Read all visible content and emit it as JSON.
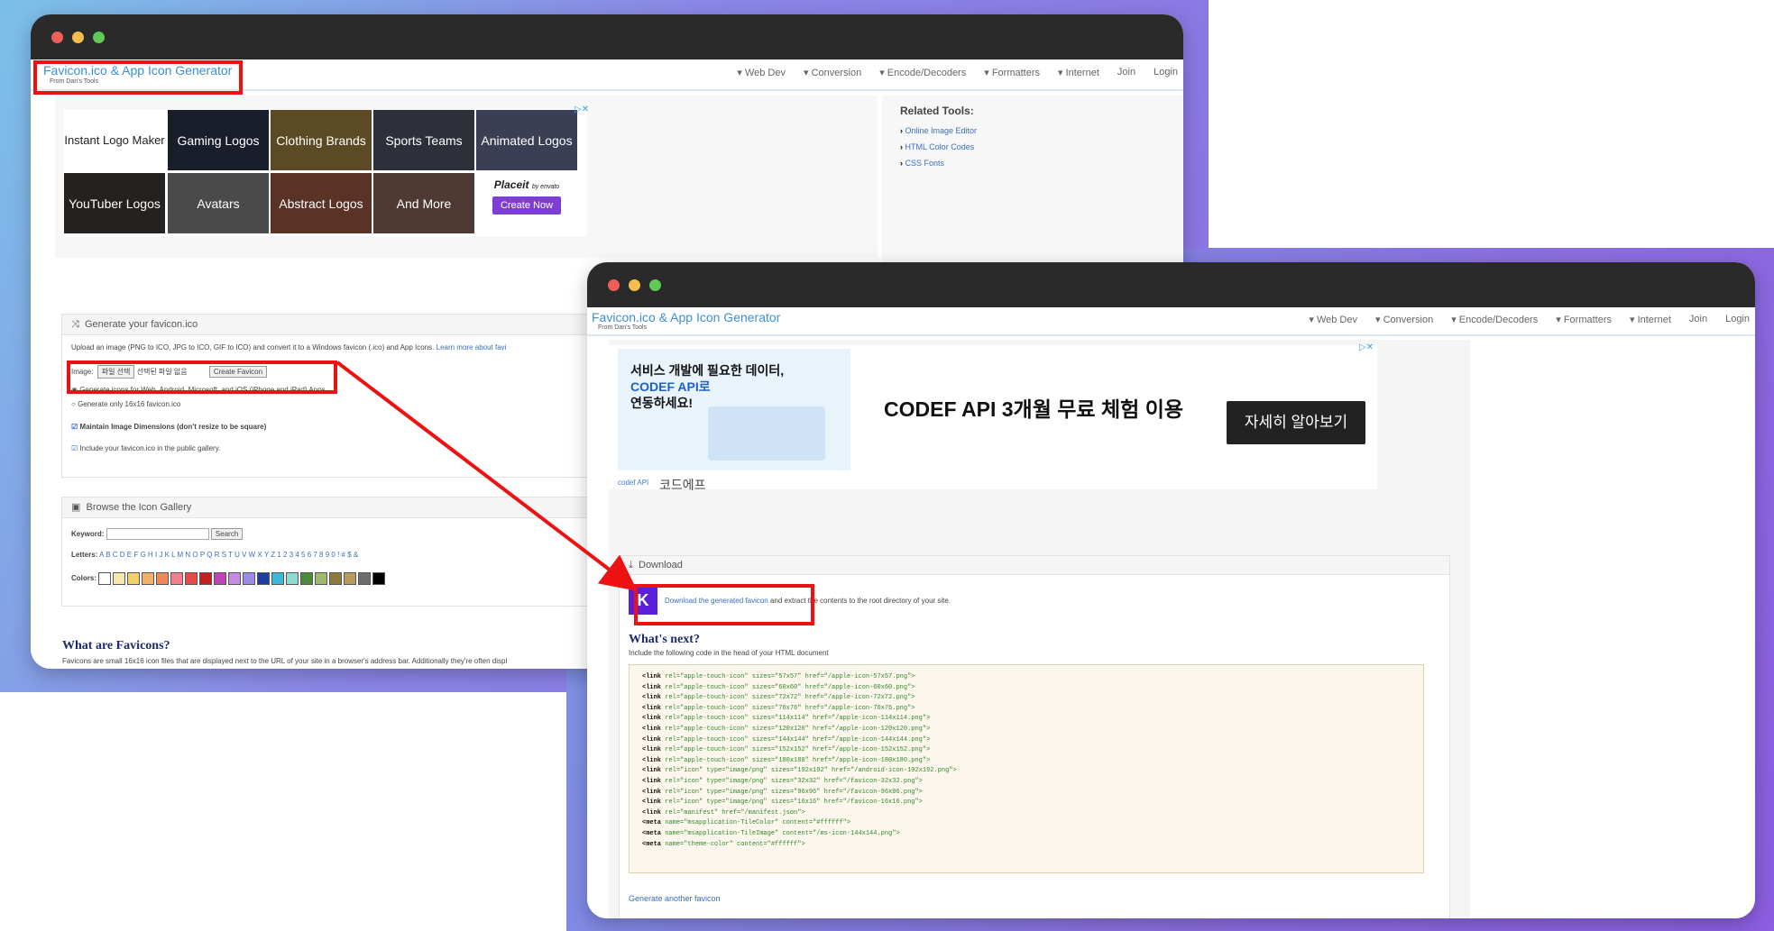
{
  "brand": {
    "title": "Favicon.ico & App Icon Generator",
    "subtitle": "From Dan's Tools"
  },
  "nav": {
    "items": [
      "Web Dev",
      "Conversion",
      "Encode/Decoders",
      "Formatters",
      "Internet",
      "Join",
      "Login"
    ]
  },
  "ad1": {
    "tiles": [
      "Instant Logo Maker",
      "Gaming Logos",
      "Clothing Brands",
      "Sports Teams",
      "Animated Logos",
      "YouTuber Logos",
      "Avatars",
      "Abstract Logos",
      "And More"
    ],
    "placeit_brand": "Placeit",
    "placeit_by": "by envato",
    "cta": "Create Now"
  },
  "related": {
    "title": "Related Tools:",
    "links": [
      "Online Image Editor",
      "HTML Color Codes",
      "CSS Fonts"
    ]
  },
  "generate": {
    "title": "Generate your favicon.ico",
    "desc": "Upload an image (PNG to ICO, JPG to ICO, GIF to ICO) and convert it to a Windows favicon (.ico) and App Icons.",
    "learn": "Learn more about favi",
    "image_label": "Image:",
    "file_button": "파일 선택",
    "file_status": "선택된 파일 없음",
    "create_button": "Create Favicon",
    "radio1": "Generate icons for Web, Android, Microsoft, and iOS (iPhone and iPad) Apps",
    "radio2": "Generate only 16x16 favicon.ico",
    "check1": "Maintain Image Dimensions (don't resize to be square)",
    "check2": "Include your favicon.ico in the public gallery."
  },
  "gallery": {
    "title": "Browse the Icon Gallery",
    "keyword_label": "Keyword:",
    "search_button": "Search",
    "letters_label": "Letters:",
    "letters": "A B C D E F G H I J K L M N O P Q R S T U V W X Y Z 1 2 3 4 5 6 7 8 9 0 ! # $ &",
    "colors_label": "Colors:",
    "colors": [
      "#ffffff",
      "#f6e7b0",
      "#f3d06a",
      "#f2b06c",
      "#ee8a5a",
      "#f07f8f",
      "#e84a4a",
      "#c41e1e",
      "#c043b5",
      "#c88ae0",
      "#9d8be8",
      "#1f3c9e",
      "#3fb8d6",
      "#8fd9d3",
      "#4c8a3b",
      "#9fb86d",
      "#8e7a3c",
      "#b79a5c",
      "#6d6d6d",
      "#000000"
    ]
  },
  "faq": {
    "title": "What are Favicons?",
    "text": "Favicons are small 16x16 icon files that are displayed next to the URL of your site in a browser's address bar. Additionally they're often displ"
  },
  "ad2": {
    "headline_ko": "서비스 개발에 필요한 데이터,",
    "brand_ko": "CODEF API로",
    "line3_ko": "연동하세요!",
    "offer": "CODEF API 3개월 무료 체험 이용",
    "cta": "자세히 알아보기",
    "logo_text": "codef API",
    "company": "코드에프"
  },
  "download": {
    "title": "Download",
    "link_text": "Download the generated favicon",
    "rest_text": " and extract the contents to the root directory of your site.",
    "icon_letter": "K"
  },
  "next": {
    "title": "What's next?",
    "subtitle": "Include the following code in the head of your HTML document",
    "code_lines": [
      [
        "link",
        "rel=\"apple-touch-icon\" sizes=\"57x57\" href=\"/apple-icon-57x57.png\">"
      ],
      [
        "link",
        "rel=\"apple-touch-icon\" sizes=\"60x60\" href=\"/apple-icon-60x60.png\">"
      ],
      [
        "link",
        "rel=\"apple-touch-icon\" sizes=\"72x72\" href=\"/apple-icon-72x72.png\">"
      ],
      [
        "link",
        "rel=\"apple-touch-icon\" sizes=\"76x76\" href=\"/apple-icon-76x76.png\">"
      ],
      [
        "link",
        "rel=\"apple-touch-icon\" sizes=\"114x114\" href=\"/apple-icon-114x114.png\">"
      ],
      [
        "link",
        "rel=\"apple-touch-icon\" sizes=\"120x120\" href=\"/apple-icon-120x120.png\">"
      ],
      [
        "link",
        "rel=\"apple-touch-icon\" sizes=\"144x144\" href=\"/apple-icon-144x144.png\">"
      ],
      [
        "link",
        "rel=\"apple-touch-icon\" sizes=\"152x152\" href=\"/apple-icon-152x152.png\">"
      ],
      [
        "link",
        "rel=\"apple-touch-icon\" sizes=\"180x180\" href=\"/apple-icon-180x180.png\">"
      ],
      [
        "link",
        "rel=\"icon\" type=\"image/png\" sizes=\"192x192\" href=\"/android-icon-192x192.png\">"
      ],
      [
        "link",
        "rel=\"icon\" type=\"image/png\" sizes=\"32x32\" href=\"/favicon-32x32.png\">"
      ],
      [
        "link",
        "rel=\"icon\" type=\"image/png\" sizes=\"96x96\" href=\"/favicon-96x96.png\">"
      ],
      [
        "link",
        "rel=\"icon\" type=\"image/png\" sizes=\"16x16\" href=\"/favicon-16x16.png\">"
      ],
      [
        "link",
        "rel=\"manifest\" href=\"/manifest.json\">"
      ],
      [
        "meta",
        "name=\"msapplication-TileColor\" content=\"#ffffff\">"
      ],
      [
        "meta",
        "name=\"msapplication-TileImage\" content=\"/ms-icon-144x144.png\">"
      ],
      [
        "meta",
        "name=\"theme-color\" content=\"#ffffff\">"
      ]
    ],
    "another": "Generate another favicon"
  }
}
